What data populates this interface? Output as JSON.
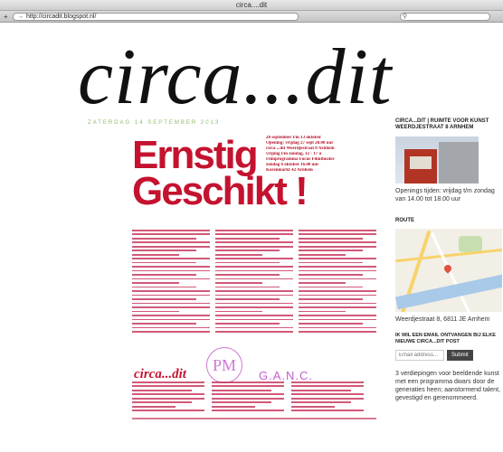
{
  "window": {
    "title": "circa....dit"
  },
  "toolbar": {
    "new_tab": "+",
    "url_arrow": "→",
    "url": "http://circadit.blogspot.nl/",
    "search_icon": "search-icon"
  },
  "blog": {
    "title": "circa...dit"
  },
  "post": {
    "date": "ZATERDAG 14 SEPTEMBER 2013",
    "poster": {
      "headline_1": "Ernstig",
      "headline_2": "Geschikt !",
      "info_lines": [
        "28 september t/m 13 oktober",
        "Opening: vrijdag 27 sept 20.00 uur",
        "circa ...dit Weerdjestraat 8 Arnhem",
        "vrijdag t/m zondag, 12 - 17 u",
        "Filmprogramma Focus Filmtheater",
        "zondag 6 oktober 16.00 uur",
        "Korenmarkt 42 Arnhem"
      ],
      "logo_circa": "circa...dit",
      "logo_pm": "PM",
      "logo_ganc": "G.A.N.C."
    }
  },
  "sidebar": {
    "title": "CIRCA...DIT | RUIMTE VOOR KUNST WEERDJESTRAAT 8 ARNHEM",
    "hours": "Openings tijden: vrijdag t/m zondag van 14.00 tot 18.00 uur",
    "route_label": "ROUTE",
    "address": "Weerdjestraat 8, 6811 JE Arnhem",
    "subscribe_title": "IK WIL EEN EMAIL ONTVANGEN BIJ ELKE NIEUWE CIRCA...DIT POST",
    "email_placeholder": "Email address...",
    "submit_label": "Submit",
    "description": "3 verdiepingen voor beeldende kunst met een programma dwars door de generaties heen; aanstormend talent, gevestigd en gerenommeerd."
  },
  "colors": {
    "accent_red": "#c4122f",
    "pm_purple": "#d077d4",
    "date_green": "#8dbd6a"
  }
}
